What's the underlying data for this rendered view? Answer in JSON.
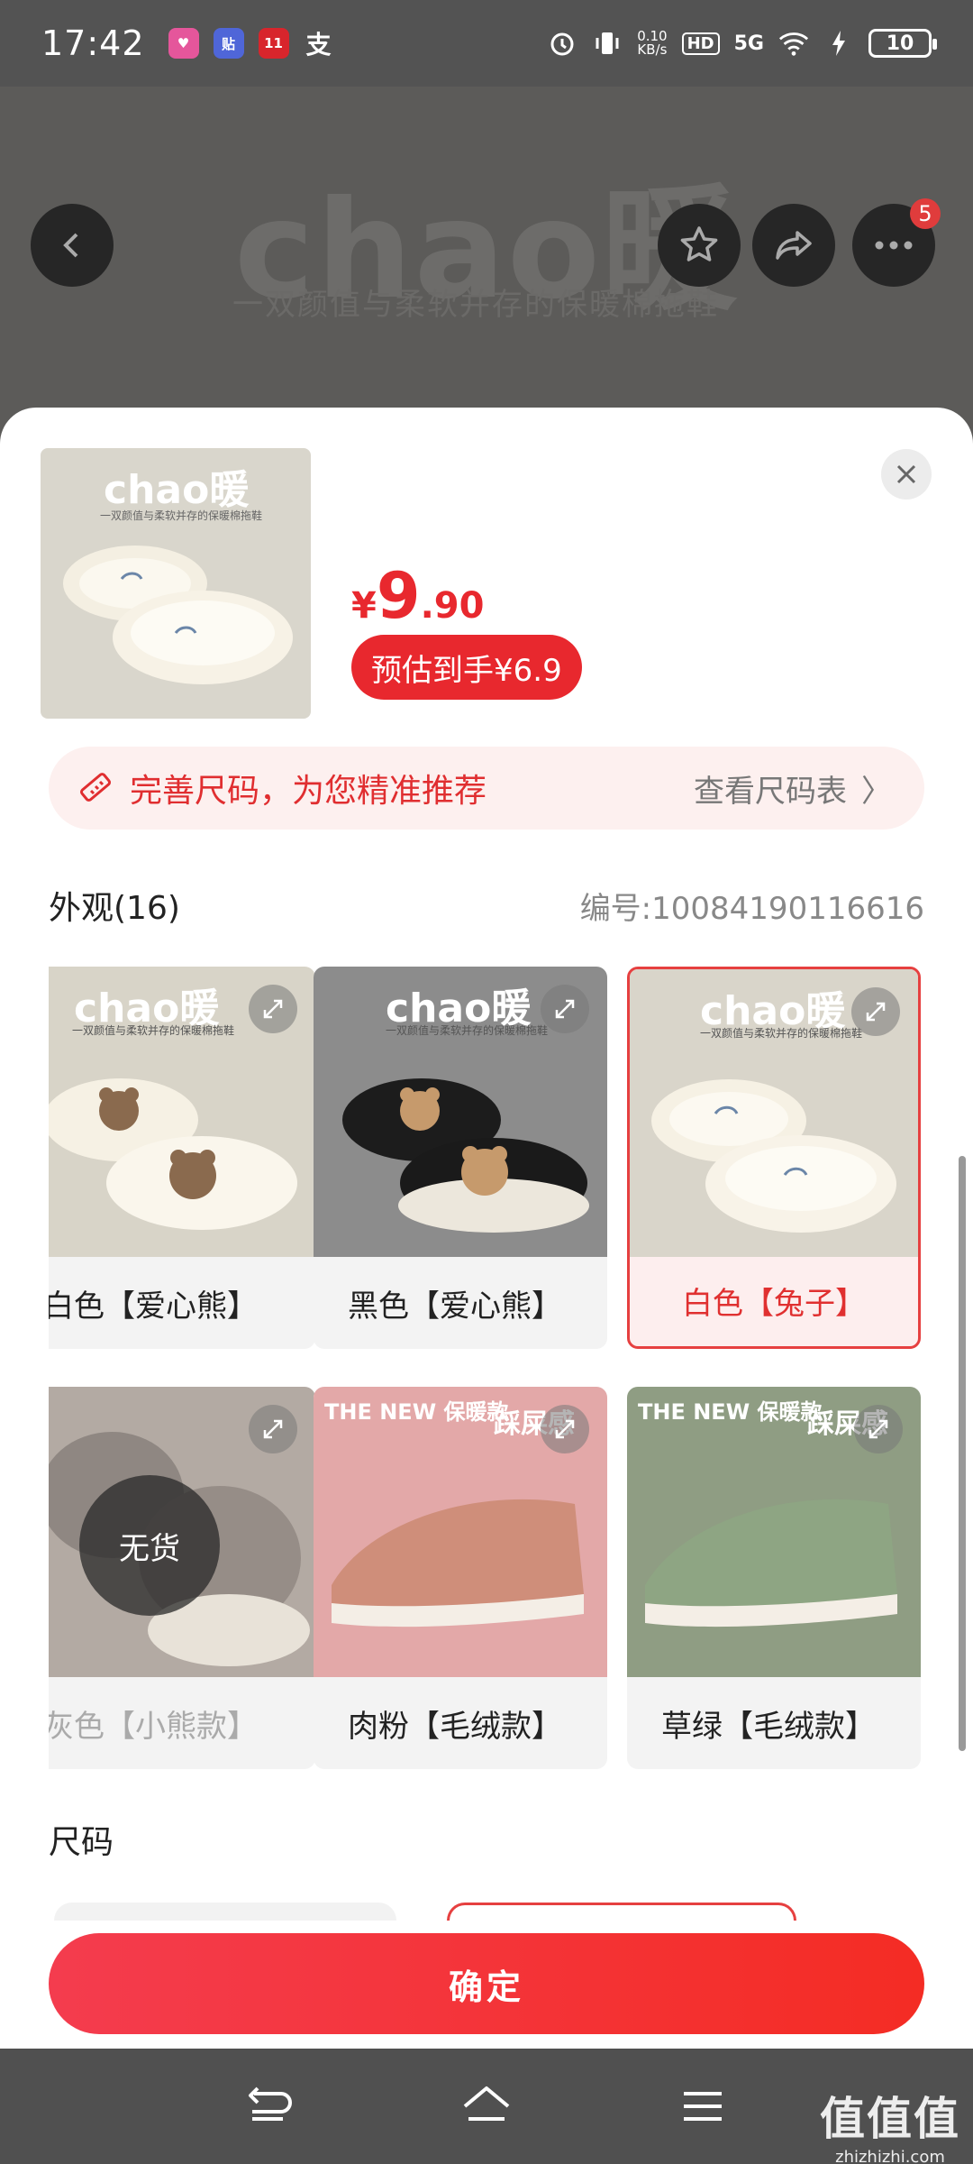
{
  "status_bar": {
    "time": "17:42",
    "apps": [
      {
        "name": "lalala-app-icon",
        "label": "lalala",
        "color": "#e5569b"
      },
      {
        "name": "tie-app-icon",
        "label": "贴",
        "color": "#4f66d8"
      },
      {
        "name": "double11-app-icon",
        "label": "11.11",
        "color": "#d8252c"
      },
      {
        "name": "alipay-app-icon",
        "label": "支",
        "color": "#535353"
      }
    ],
    "net_speed": "0.10",
    "net_unit": "KB/s",
    "hd": "HD",
    "signal": "5G",
    "battery": "10"
  },
  "background": {
    "brand": "chao暖",
    "subtitle": "一双颜值与柔软并存的保暖棉拖鞋",
    "more_badge": "5"
  },
  "product": {
    "price_currency": "¥",
    "price_integer": "9",
    "price_decimal": ".90",
    "estimated_label": "预估到手¥6.9",
    "image_brand": "chao暖",
    "image_subtitle": "一双颜值与柔软并存的保暖棉拖鞋"
  },
  "size_tip": {
    "text": "完善尺码，为您精准推荐",
    "link": "查看尺码表",
    "chevron": "〉"
  },
  "appearance": {
    "title": "外观(16)",
    "code": "编号:10084190116616",
    "soldout_label": "无货",
    "items": [
      {
        "label": "白色【爱心熊】",
        "brand": "chao暖",
        "sub": "一双颜值与柔软并存的保暖棉拖鞋"
      },
      {
        "label": "黑色【爱心熊】",
        "brand": "chao暖",
        "sub": "一双颜值与柔软并存的保暖棉拖鞋"
      },
      {
        "label": "白色【兔子】",
        "brand": "chao暖",
        "sub": "一双颜值与柔软并存的保暖棉拖鞋"
      },
      {
        "label": "灰色【小熊款】"
      },
      {
        "label": "肉粉【毛绒款】",
        "tag_left": "THE NEW 保暖款",
        "tag_right": "踩屎感"
      },
      {
        "label": "草绿【毛绒款】",
        "tag_left": "THE NEW 保暖款",
        "tag_right": "踩屎感"
      }
    ]
  },
  "size_section": {
    "title": "尺码"
  },
  "confirm_label": "确定",
  "watermark": {
    "big": "值值值",
    "small": "zhizhizhi.com"
  },
  "colors": {
    "accent": "#e8282e",
    "selected_bg": "#fdeeee"
  }
}
